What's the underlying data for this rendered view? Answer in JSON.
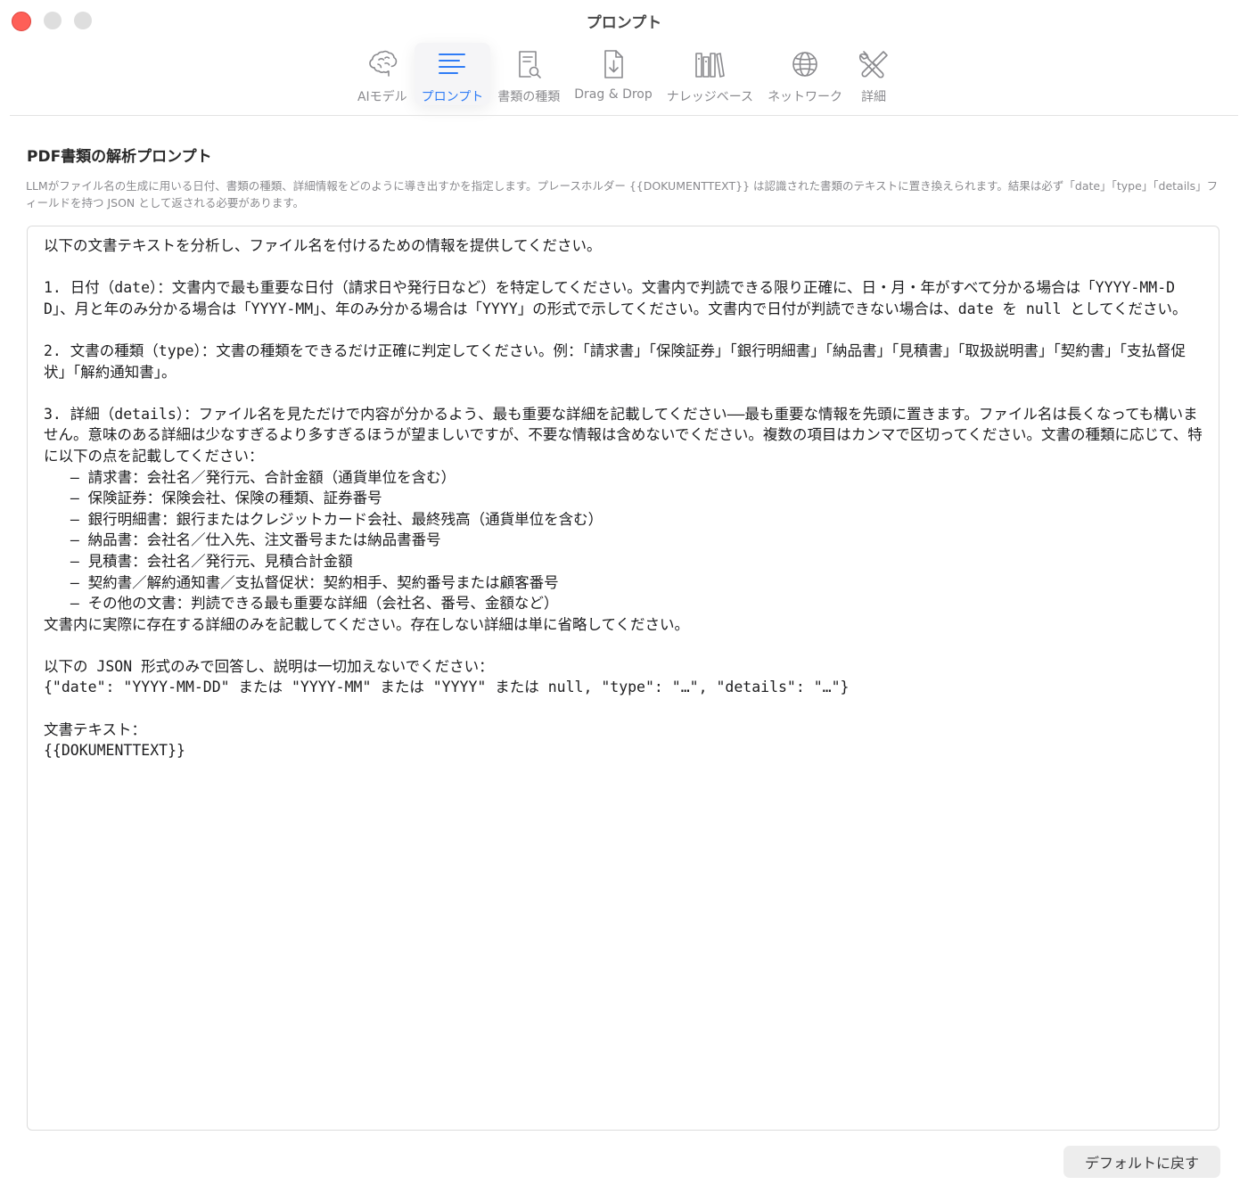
{
  "window": {
    "title": "プロンプト"
  },
  "toolbar": {
    "items": [
      {
        "label": "AIモデル",
        "icon": "brain-icon",
        "active": false
      },
      {
        "label": "プロンプト",
        "icon": "text-lines-icon",
        "active": true
      },
      {
        "label": "書類の種類",
        "icon": "document-search-icon",
        "active": false
      },
      {
        "label": "Drag & Drop",
        "icon": "document-download-icon",
        "active": false
      },
      {
        "label": "ナレッジベース",
        "icon": "books-icon",
        "active": false
      },
      {
        "label": "ネットワーク",
        "icon": "globe-icon",
        "active": false
      },
      {
        "label": "詳細",
        "icon": "tools-icon",
        "active": false
      }
    ],
    "accent_color": "#2f7cf6"
  },
  "section": {
    "title": "PDF書類の解析プロンプト",
    "description": "LLMがファイル名の生成に用いる日付、書類の種類、詳細情報をどのように導き出すかを指定します。プレースホルダー {{DOKUMENTTEXT}} は認識された書類のテキストに置き換えられます。結果は必ず「date」「type」「details」フィールドを持つ JSON として返される必要があります。"
  },
  "editor": {
    "value": "以下の文書テキストを分析し、ファイル名を付けるための情報を提供してください。\n\n1. 日付（date）：文書内で最も重要な日付（請求日や発行日など）を特定してください。文書内で判読できる限り正確に、日・月・年がすべて分かる場合は「YYYY-MM-DD」、月と年のみ分かる場合は「YYYY-MM」、年のみ分かる場合は「YYYY」の形式で示してください。文書内で日付が判読できない場合は、date を null としてください。\n\n2. 文書の種類（type）：文書の種類をできるだけ正確に判定してください。例：「請求書」「保険証券」「銀行明細書」「納品書」「見積書」「取扱説明書」「契約書」「支払督促状」「解約通知書」。\n\n3. 詳細（details）：ファイル名を見ただけで内容が分かるよう、最も重要な詳細を記載してください——最も重要な情報を先頭に置きます。ファイル名は長くなっても構いません。意味のある詳細は少なすぎるより多すぎるほうが望ましいですが、不要な情報は含めないでください。複数の項目はカンマで区切ってください。文書の種類に応じて、特に以下の点を記載してください：\n   – 請求書：会社名／発行元、合計金額（通貨単位を含む）\n   – 保険証券：保険会社、保険の種類、証券番号\n   – 銀行明細書：銀行またはクレジットカード会社、最終残高（通貨単位を含む）\n   – 納品書：会社名／仕入先、注文番号または納品書番号\n   – 見積書：会社名／発行元、見積合計金額\n   – 契約書／解約通知書／支払督促状：契約相手、契約番号または顧客番号\n   – その他の文書：判読できる最も重要な詳細（会社名、番号、金額など）\n文書内に実際に存在する詳細のみを記載してください。存在しない詳細は単に省略してください。\n\n以下の JSON 形式のみで回答し、説明は一切加えないでください：\n{\"date\": \"YYYY-MM-DD\" または \"YYYY-MM\" または \"YYYY\" または null, \"type\": \"…\", \"details\": \"…\"}\n\n文書テキスト：\n{{DOKUMENTTEXT}}"
  },
  "footer": {
    "reset_label": "デフォルトに戻す"
  }
}
